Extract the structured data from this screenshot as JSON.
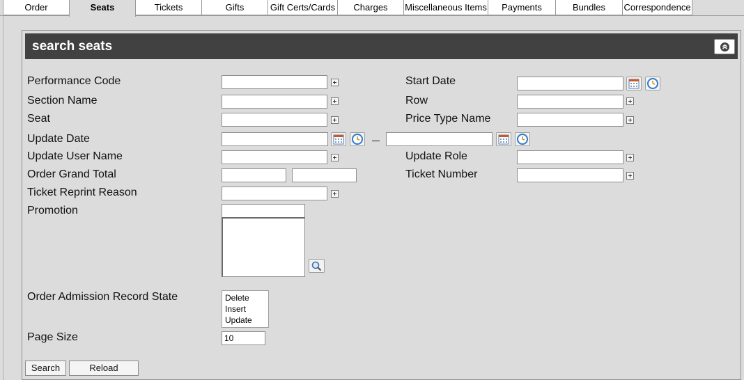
{
  "tabs": [
    {
      "label": "Order"
    },
    {
      "label": "Seats"
    },
    {
      "label": "Tickets"
    },
    {
      "label": "Gifts"
    },
    {
      "label": "Gift Certs/Cards"
    },
    {
      "label": "Charges"
    },
    {
      "label": "Miscellaneous Items"
    },
    {
      "label": "Payments"
    },
    {
      "label": "Bundles"
    },
    {
      "label": "Correspondence"
    }
  ],
  "active_tab": "Seats",
  "panel": {
    "title": "search seats"
  },
  "fields": {
    "performance_code": {
      "label": "Performance Code",
      "value": ""
    },
    "start_date": {
      "label": "Start Date",
      "value": ""
    },
    "section_name": {
      "label": "Section Name",
      "value": ""
    },
    "row": {
      "label": "Row",
      "value": ""
    },
    "seat": {
      "label": "Seat",
      "value": ""
    },
    "price_type_name": {
      "label": "Price Type Name",
      "value": ""
    },
    "update_date": {
      "label": "Update Date",
      "from": "",
      "to": ""
    },
    "update_user_name": {
      "label": "Update User Name",
      "value": ""
    },
    "update_role": {
      "label": "Update Role",
      "value": ""
    },
    "order_grand_total": {
      "label": "Order Grand Total",
      "min": "",
      "max": ""
    },
    "ticket_number": {
      "label": "Ticket Number",
      "value": ""
    },
    "ticket_reprint_reason": {
      "label": "Ticket Reprint Reason",
      "value": ""
    },
    "promotion": {
      "label": "Promotion",
      "value": ""
    },
    "order_admission_record_state": {
      "label": "Order Admission Record State",
      "options": [
        "Delete",
        "Insert",
        "Update"
      ]
    },
    "page_size": {
      "label": "Page Size",
      "value": "10"
    }
  },
  "buttons": {
    "search": "Search",
    "reload": "Reload"
  }
}
